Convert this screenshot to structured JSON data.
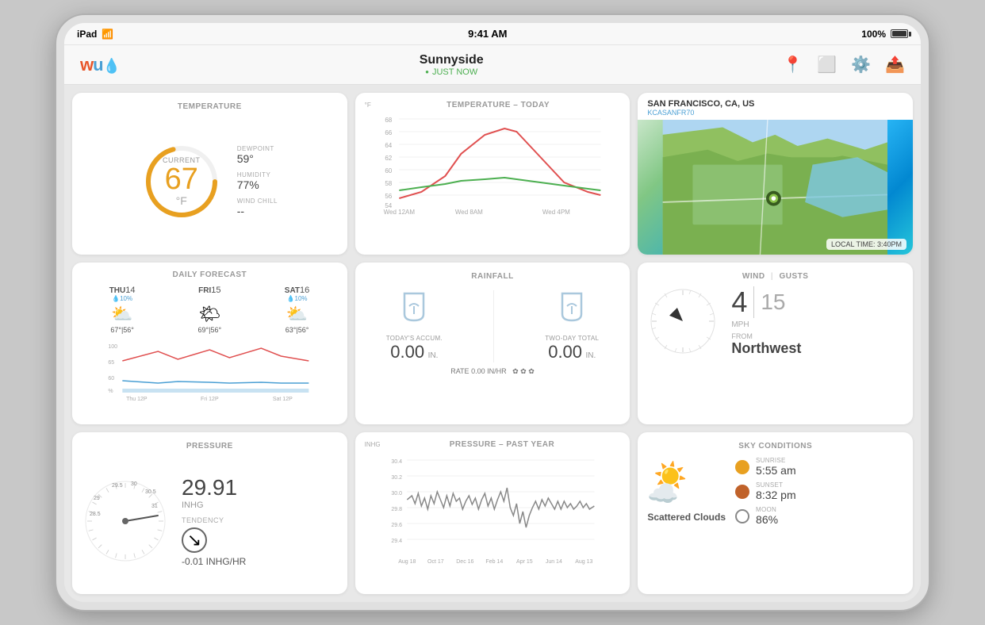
{
  "device": {
    "model": "iPad",
    "wifi": true,
    "time": "9:41 AM",
    "battery": "100%"
  },
  "nav": {
    "location": "Sunnyside",
    "status": "JUST NOW",
    "status_color": "#4CAF50"
  },
  "temperature": {
    "card_title": "TEMPERATURE",
    "current_label": "CURRENT",
    "value": "67",
    "unit": "°F",
    "dewpoint_label": "DEWPOINT",
    "dewpoint": "59°",
    "humidity_label": "HUMIDITY",
    "humidity": "77%",
    "wind_chill_label": "WIND CHILL",
    "wind_chill": "--"
  },
  "temp_chart": {
    "title": "TEMPERATURE – TODAY",
    "y_label": "°F",
    "x_labels": [
      "Wed 12AM",
      "Wed 8AM",
      "Wed 4PM"
    ]
  },
  "daily_forecast": {
    "title": "DAILY FORECAST",
    "days": [
      {
        "name": "THU",
        "num": "14",
        "precip": "10%",
        "icon": "⛅",
        "high": "67°",
        "low": "56°"
      },
      {
        "name": "FRI",
        "num": "15",
        "precip": "",
        "icon": "🌤",
        "high": "69°",
        "low": "56°"
      },
      {
        "name": "SAT",
        "num": "16",
        "precip": "10%",
        "icon": "⛅",
        "high": "63°",
        "low": "56°"
      }
    ],
    "x_labels": [
      "Thu 12P",
      "Fri 12P",
      "Sat 12P"
    ]
  },
  "map": {
    "title": "SAN FRANCISCO, CA, US",
    "station": "KCASANFR70",
    "timestamp": "LOCAL TIME: 3:40PM"
  },
  "rainfall": {
    "title": "RAINFALL",
    "today_label": "TODAY'S ACCUM.",
    "today_value": "0.00",
    "today_unit": "IN.",
    "twoday_label": "TWO-DAY TOTAL",
    "twoday_value": "0.00",
    "twoday_unit": "IN.",
    "rate_label": "RATE",
    "rate_value": "0.00",
    "rate_unit": "IN/HR"
  },
  "wind": {
    "title": "WIND",
    "gusts_label": "GUSTS",
    "speed": "4",
    "gust": "15",
    "unit": "MPH",
    "from_label": "FROM",
    "direction": "Northwest"
  },
  "pressure": {
    "title": "PRESSURE",
    "value": "29.91",
    "unit": "INHG",
    "tendency_label": "TENDENCY",
    "tendency_value": "-0.01 INHG/HR"
  },
  "pressure_chart": {
    "title": "PRESSURE – PAST YEAR",
    "y_label": "INHG",
    "x_labels": [
      "Aug 18",
      "Oct 17",
      "Dec 16",
      "Feb 14",
      "Apr 15",
      "Jun 14",
      "Aug 13"
    ]
  },
  "sky": {
    "title": "SKY CONDITIONS",
    "condition": "Scattered Clouds",
    "sunrise_label": "SUNRISE",
    "sunrise": "5:55 am",
    "sunset_label": "SUNSET",
    "sunset": "8:32 pm",
    "moon_label": "MOON",
    "moon": "86%"
  }
}
